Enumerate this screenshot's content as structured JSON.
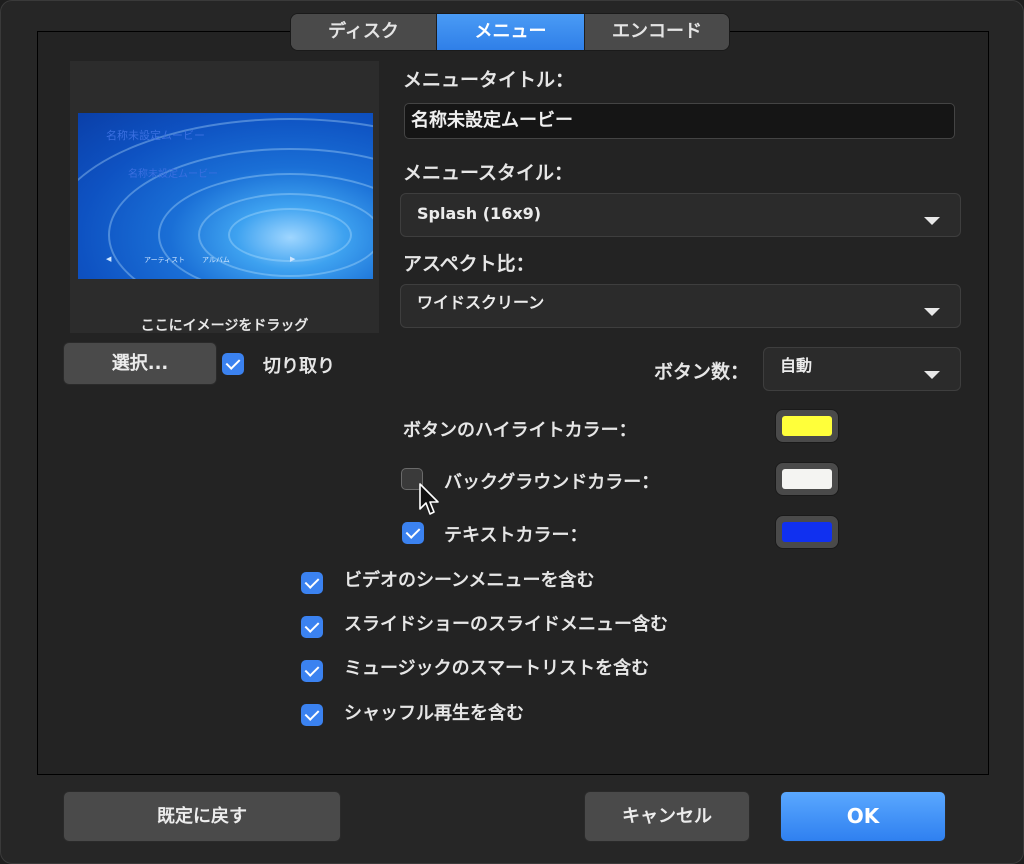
{
  "tabs": [
    {
      "label": "ディスク",
      "selected": false
    },
    {
      "label": "メニュー",
      "selected": true
    },
    {
      "label": "エンコード",
      "selected": false
    }
  ],
  "preview": {
    "title_1": "名称未設定ムービー",
    "title_2": "名称未設定ムービー",
    "nav_artist": "アーティスト",
    "nav_album": "アルバム",
    "caption": "ここにイメージをドラッグ"
  },
  "select_button": "選択...",
  "crop": {
    "label": "切り取り",
    "checked": true
  },
  "menu_title": {
    "label": "メニュータイトル：",
    "value": "名称未設定ムービー"
  },
  "menu_style": {
    "label": "メニュースタイル：",
    "value": "Splash (16x9)"
  },
  "aspect": {
    "label": "アスペクト比：",
    "value": "ワイドスクリーン"
  },
  "button_count": {
    "label": "ボタン数：",
    "value": "自動"
  },
  "colors": {
    "highlight": {
      "label": "ボタンのハイライトカラー：",
      "color": "#ffff3a"
    },
    "background": {
      "label": "バックグラウンドカラー：",
      "color": "#f4f4f2",
      "checked": false
    },
    "text": {
      "label": "テキストカラー：",
      "color": "#1030f0",
      "checked": true
    }
  },
  "options": [
    {
      "label": "ビデオのシーンメニューを含む",
      "checked": true
    },
    {
      "label": "スライドショーのスライドメニュー含む",
      "checked": true
    },
    {
      "label": "ミュージックのスマートリストを含む",
      "checked": true
    },
    {
      "label": "シャッフル再生を含む",
      "checked": true
    }
  ],
  "footer": {
    "reset": "既定に戻す",
    "cancel": "キャンセル",
    "ok": "OK"
  }
}
